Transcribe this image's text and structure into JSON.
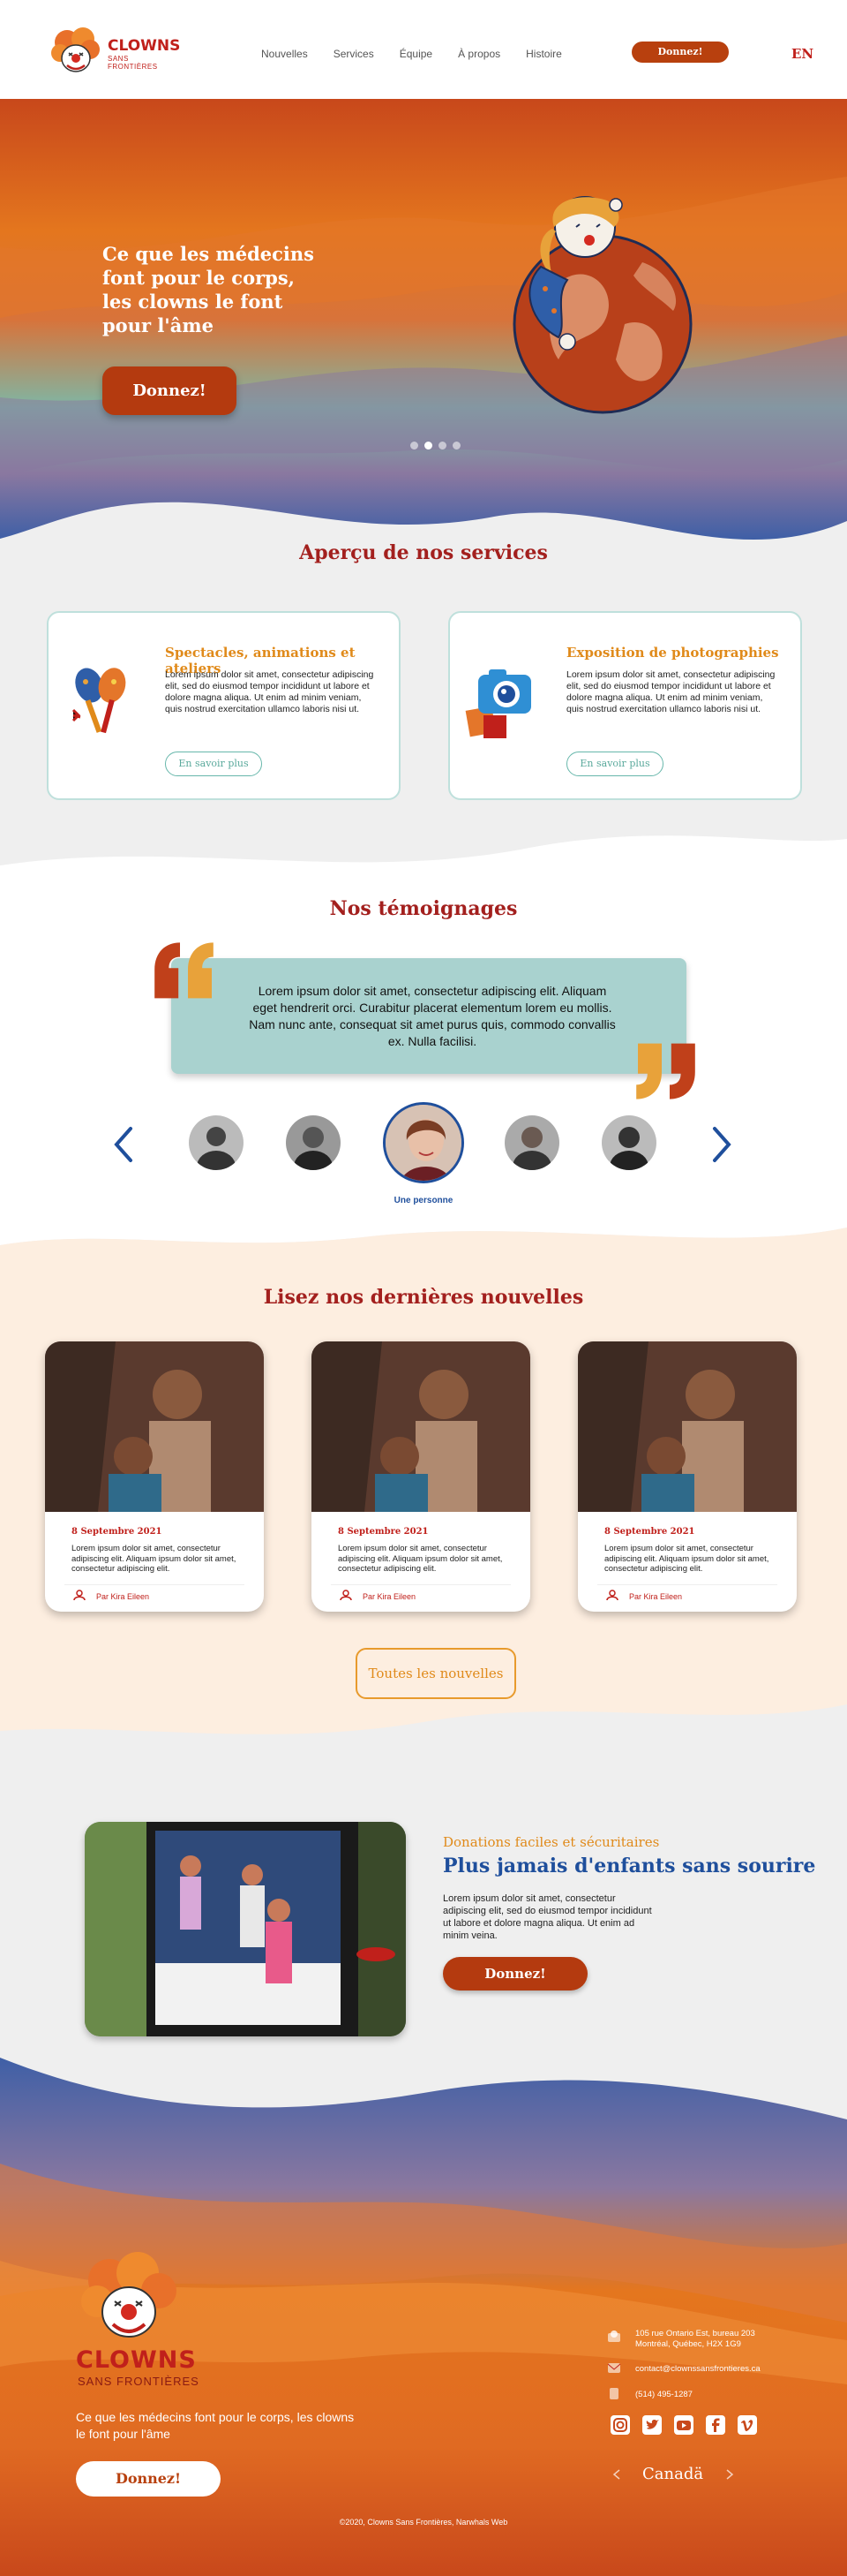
{
  "brand": {
    "name": "CLOWNS",
    "sub": "SANS FRONTIÈRES"
  },
  "nav": {
    "items": [
      "Nouvelles",
      "Services",
      "Équipe",
      "À propos",
      "Histoire"
    ],
    "donate_label": "Donnez!",
    "lang": "EN"
  },
  "hero": {
    "title": "Ce que les médecins font pour le corps, les clowns le font pour l'âme",
    "button": "Donnez!",
    "slides": 4,
    "active_slide": 2
  },
  "services": {
    "title": "Aperçu de nos services",
    "cards": [
      {
        "title": "Spectacles, animations et ateliers",
        "text": "Lorem ipsum dolor sit amet, consectetur adipiscing elit, sed do eiusmod tempor incididunt ut labore et dolore magna aliqua. Ut enim ad minim veniam, quis nostrud exercitation ullamco laboris nisi ut.",
        "button": "En savoir plus",
        "icon": "maracas-icon"
      },
      {
        "title": "Exposition de photographies",
        "text": "Lorem ipsum dolor sit amet, consectetur adipiscing elit, sed do eiusmod tempor incididunt ut labore et dolore magna aliqua. Ut enim ad minim veniam, quis nostrud exercitation ullamco laboris nisi ut.",
        "button": "En savoir plus",
        "icon": "camera-icon"
      }
    ]
  },
  "testimonials": {
    "title": "Nos témoignages",
    "quote": "Lorem ipsum dolor sit amet, consectetur adipiscing elit. Aliquam eget hendrerit orci. Curabitur placerat elementum lorem eu mollis. Nam nunc ante, consequat sit amet purus quis, commodo convallis ex. Nulla facilisi.",
    "active_name": "Une personne"
  },
  "news": {
    "title": "Lisez nos dernières nouvelles",
    "items": [
      {
        "date": "8 Septembre 2021",
        "text": "Lorem ipsum dolor sit amet, consectetur adipiscing elit. Aliquam ipsum dolor sit amet, consectetur adipiscing elit.",
        "author": "Par Kira Eileen"
      },
      {
        "date": "8 Septembre 2021",
        "text": "Lorem ipsum dolor sit amet, consectetur adipiscing elit. Aliquam ipsum dolor sit amet, consectetur adipiscing elit.",
        "author": "Par Kira Eileen"
      },
      {
        "date": "8 Septembre 2021",
        "text": "Lorem ipsum dolor sit amet, consectetur adipiscing elit. Aliquam ipsum dolor sit amet, consectetur adipiscing elit.",
        "author": "Par Kira Eileen"
      }
    ],
    "all_button": "Toutes les nouvelles"
  },
  "donation": {
    "subtitle": "Donations faciles et sécuritaires",
    "title": "Plus jamais d'enfants sans sourire",
    "text": "Lorem ipsum dolor sit amet, consectetur adipiscing elit, sed do eiusmod tempor incididunt ut labore et dolore magna aliqua. Ut enim ad minim veina.",
    "button": "Donnez!"
  },
  "footer": {
    "brand": "CLOWNS",
    "brand_sub": "SANS FRONTIÈRES",
    "tagline": "Ce que les médecins font pour le corps, les clowns le font pour l'âme",
    "button": "Donnez!",
    "address_1": "105 rue Ontario Est, bureau 203",
    "address_2": "Montréal, Québec, H2X 1G9",
    "email": "contact@clownssansfrontieres.ca",
    "phone": "(514) 495-1287",
    "social": [
      "instagram-icon",
      "twitter-icon",
      "youtube-icon",
      "facebook-icon",
      "vimeo-icon"
    ],
    "canada": "Canadä",
    "copyright": "©2020, Clowns Sans Frontières, Narwhals Web"
  },
  "colors": {
    "brand_red": "#c0201b",
    "orange": "#e08a1a",
    "donate": "#b43a0f",
    "teal": "#a9d2cf",
    "blue": "#1f4f9c"
  }
}
